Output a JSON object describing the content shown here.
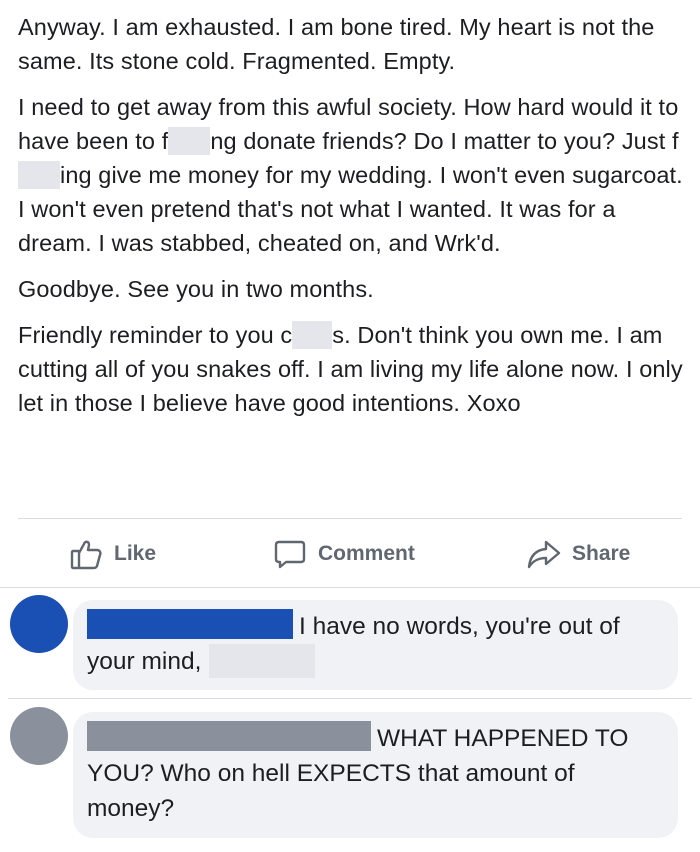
{
  "post": {
    "paragraphs": [
      {
        "segments": [
          "Anyway. I am exhausted. I am bone tired. My heart is not the same. Its stone cold. Fragmented. Empty."
        ]
      },
      {
        "segments": [
          "I need to get away from this awful society. How hard would it to have been to f",
          "ng donate friends? Do I matter to you? Just f",
          "ing give me money for my wedding. I won't even sugarcoat. I won't even pretend that's not what I wanted. It was for a dream. I was stabbed, cheated on, and Wrk'd."
        ]
      },
      {
        "segments": [
          "Goodbye. See you in two months."
        ]
      },
      {
        "segments": [
          "Friendly reminder to you c",
          "s. Don't think you own me. I am cutting all of you snakes off. I am living my life alone now. I only let in those I believe have good intentions. Xoxo"
        ]
      }
    ]
  },
  "actions": {
    "like": "Like",
    "comment": "Comment",
    "share": "Share"
  },
  "comments": [
    {
      "avatar_color": "#1a4fb3",
      "name_bar_color": "#1a4fb3",
      "text_before": "I have no words, you're out of your mind,",
      "text_after": ""
    },
    {
      "avatar_color": "#8a919c",
      "name_bar_color": "#8a919c",
      "text_before": "WHAT HAPPENED TO YOU? Who on hell EXPECTS that amount of money?",
      "text_after": ""
    }
  ],
  "colors": {
    "redaction": "#e4e6eb",
    "action_text": "#606770",
    "bubble_bg": "#f0f2f5"
  }
}
